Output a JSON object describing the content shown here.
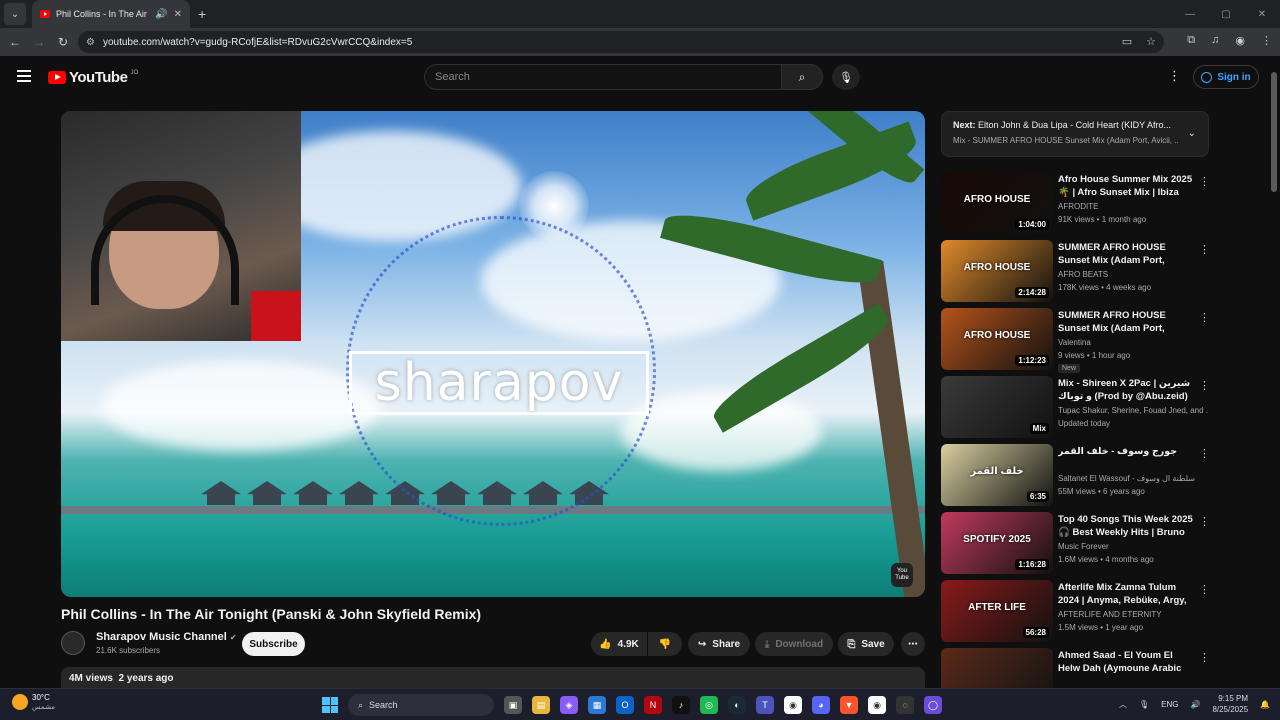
{
  "browser": {
    "tab_title": "Phil Collins - In The Air Toni",
    "url": "youtube.com/watch?v=gudg-RCofjE&list=RDvuG2cVwrCCQ&index=5"
  },
  "header": {
    "logo_text": "YouTube",
    "country_code": "JO",
    "search_placeholder": "Search",
    "signin_label": "Sign in"
  },
  "player": {
    "brand_text": "sharapov",
    "watermark": "You Tube"
  },
  "video": {
    "title": "Phil Collins - In The Air Tonight (Panski & John Skyfield Remix)",
    "channel": "Sharapov Music Channel",
    "subscribers": "21.6K subscribers",
    "subscribe_label": "Subscribe",
    "likes": "4.9K",
    "share_label": "Share",
    "download_label": "Download",
    "save_label": "Save",
    "views": "4M views",
    "age": "2 years ago"
  },
  "next": {
    "label": "Next:",
    "title": "Elton John & Dua Lipa - Cold Heart (KIDY Afro...",
    "playlist": "Mix - SUMMER AFRO HOUSE Sunset Mix (Adam Port, Avicii, ..."
  },
  "recommendations": [
    {
      "title": "Afro House Summer Mix 2025 🌴 | Afro Sunset Mix | Ibiza Mi...",
      "channel": "AFRODITE",
      "meta": "91K views • 1 month ago",
      "duration": "1:04:00",
      "thumb_text": "AFRO HOUSE",
      "color": "#1a0a05",
      "badge": ""
    },
    {
      "title": "SUMMER AFRO HOUSE Sunset Mix (Adam Port, Avicii, The ...",
      "channel": "AFRO BEATS",
      "meta": "178K views • 4 weeks ago",
      "duration": "2:14:28",
      "thumb_text": "AFRO HOUSE",
      "color": "#e08a2a",
      "badge": ""
    },
    {
      "title": "SUMMER AFRO HOUSE Sunset Mix (Adam Port, Hugel, Avicii, ...",
      "channel": "Valentina",
      "meta": "9 views • 1 hour ago",
      "duration": "1:12:23",
      "thumb_text": "AFRO HOUSE",
      "color": "#b5531a",
      "badge": "New"
    },
    {
      "title": "Mix - Shireen X 2Pac | شيرين و توباك (Prod by @Abu.zeid)",
      "channel": "Tupac Shakur, Sherine, Fouad Jned, and ...",
      "meta": "Updated today",
      "duration": "Mix",
      "thumb_text": "",
      "color": "#3a3a3a",
      "badge": ""
    },
    {
      "title": "جورج وسوف - خلف القمر",
      "channel": "Saltanet El Wassouf - سلطنة ال وسوف",
      "meta": "55M views • 6 years ago",
      "duration": "6:35",
      "thumb_text": "خلف القمر",
      "color": "#d9cfa0",
      "badge": ""
    },
    {
      "title": "Top 40 Songs This Week 2025 🎧 Best Weekly Hits | Bruno ...",
      "channel": "Music Forever",
      "meta": "1.6M views • 4 months ago",
      "duration": "1:16:28",
      "thumb_text": "SPOTIFY 2025",
      "color": "#c23a5c",
      "badge": ""
    },
    {
      "title": "Afterlife Mix Zamna Tulum 2024 | Anyma, Rebüke, Argy, ...",
      "channel": "AFTERLIFE AND ETERNITY",
      "meta": "1.5M views • 1 year ago",
      "duration": "56:28",
      "thumb_text": "AFTER LIFE",
      "color": "#8a1a1a",
      "badge": ""
    },
    {
      "title": "Ahmed Saad - El Youm El Helw Dah (Aymoune Arabic Afro ...",
      "channel": "",
      "meta": "",
      "duration": "",
      "thumb_text": "",
      "color": "#5a2a1a",
      "badge": ""
    }
  ],
  "taskbar": {
    "temperature": "30°C",
    "condition": "مشمس",
    "search_label": "Search",
    "language": "ENG",
    "time": "9:15 PM",
    "date": "8/25/2025"
  }
}
